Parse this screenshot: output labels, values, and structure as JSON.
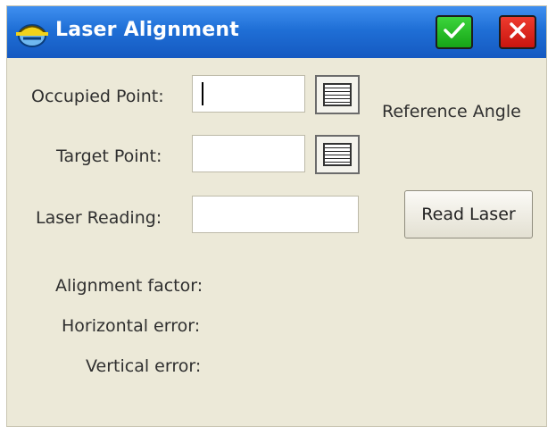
{
  "window": {
    "title": "Laser Alignment",
    "app_icon": "hard-hat-icon",
    "ok_icon": "checkmark-icon",
    "close_icon": "close-icon"
  },
  "form": {
    "occupied_point": {
      "label": "Occupied Point:",
      "value": ""
    },
    "target_point": {
      "label": "Target Point:",
      "value": ""
    },
    "laser_reading": {
      "label": "Laser Reading:",
      "value": ""
    },
    "list_button_icon": "list-icon"
  },
  "reference_angle_label": "Reference Angle",
  "read_laser_label": "Read Laser",
  "results": {
    "alignment_factor": "Alignment factor:",
    "horizontal_error": "Horizontal error:",
    "vertical_error": "Vertical error:"
  },
  "colors": {
    "title_bar": "#1f6fd6",
    "background": "#ECE9D8",
    "ok_green": "#22b522",
    "close_red": "#d9201a"
  }
}
